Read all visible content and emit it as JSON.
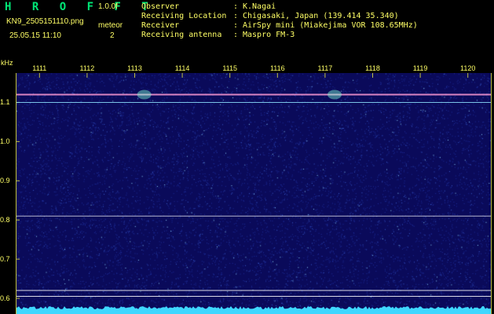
{
  "header": {
    "app_title": "H R O F F T",
    "version": "1.0.0f",
    "filename": "KN9_2505151110.png",
    "meteor_label": "meteor",
    "datetime": "25.05.15 11:10",
    "meteor_count": "2",
    "info": [
      {
        "label": "Observer",
        "value": "K.Nagai"
      },
      {
        "label": "Receiving Location",
        "value": "Chigasaki, Japan (139.414 35.340)"
      },
      {
        "label": "Receiver",
        "value": "AirSpy mini (Miakejima VOR 108.65MHz)"
      },
      {
        "label": "Receiving antenna",
        "value": "Maspro FM-3"
      }
    ]
  },
  "colors": {
    "background": "#0a0a5a",
    "text": "#ffff66",
    "title": "#00e676",
    "trace": "#3fd7ff",
    "line": "#ffffff"
  },
  "chart_data": {
    "type": "heatmap",
    "x_unit": "",
    "y_unit": "kHz",
    "x_ticks": [
      "1111",
      "1112",
      "1113",
      "1114",
      "1115",
      "1116",
      "1117",
      "1118",
      "1119",
      "1120"
    ],
    "x_range": [
      1110.5,
      1120.5
    ],
    "y_ticks": [
      "1.1",
      "1.0",
      "0.9",
      "0.8",
      "0.7",
      "0.6"
    ],
    "y_range": [
      0.56,
      1.175
    ],
    "reference_lines_khz": [
      1.12,
      1.1,
      0.81,
      0.62,
      0.605
    ],
    "meteor_echoes": [
      {
        "x": 1113.2,
        "y_khz": 1.12
      },
      {
        "x": 1117.2,
        "y_khz": 1.12
      }
    ]
  }
}
